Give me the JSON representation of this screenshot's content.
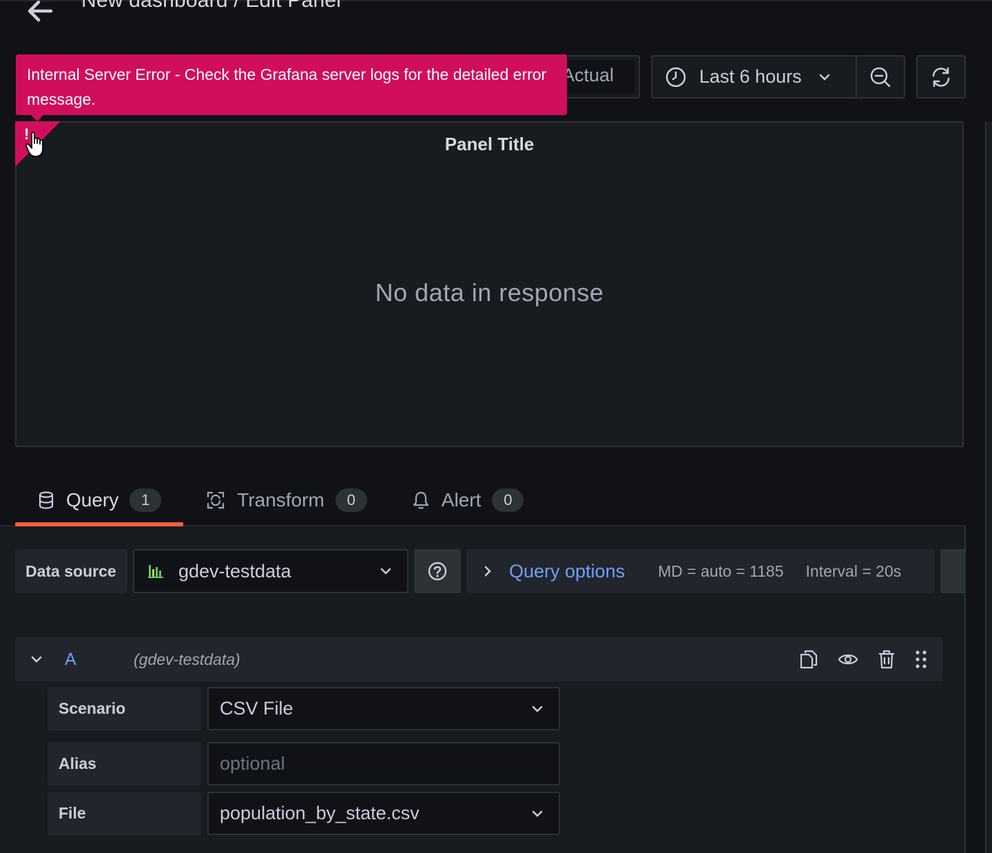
{
  "header": {
    "title": "New dashboard / Edit Panel"
  },
  "toolbar": {
    "actual_label": "Actual",
    "time_range": "Last 6 hours"
  },
  "error": {
    "message": "Internal Server Error - Check the Grafana server logs for the detailed error message."
  },
  "panel": {
    "title": "Panel Title",
    "empty_text": "No data in response"
  },
  "tabs": [
    {
      "label": "Query",
      "count": "1",
      "icon": "database-icon",
      "active": true
    },
    {
      "label": "Transform",
      "count": "0",
      "icon": "transform-icon",
      "active": false
    },
    {
      "label": "Alert",
      "count": "0",
      "icon": "bell-icon",
      "active": false
    }
  ],
  "datasource": {
    "label": "Data source",
    "value": "gdev-testdata"
  },
  "query_options": {
    "label": "Query options",
    "md": "MD = auto = 1185",
    "interval": "Interval = 20s"
  },
  "query": {
    "ref_id": "A",
    "datasource_name": "(gdev-testdata)",
    "fields": {
      "scenario": {
        "label": "Scenario",
        "value": "CSV File"
      },
      "alias": {
        "label": "Alias",
        "value": "",
        "placeholder": "optional"
      },
      "file": {
        "label": "File",
        "value": "population_by_state.csv"
      }
    }
  },
  "colors": {
    "error": "#d10e5c",
    "accent_link": "#6e9fff",
    "active_tab": "#f55f3e"
  }
}
